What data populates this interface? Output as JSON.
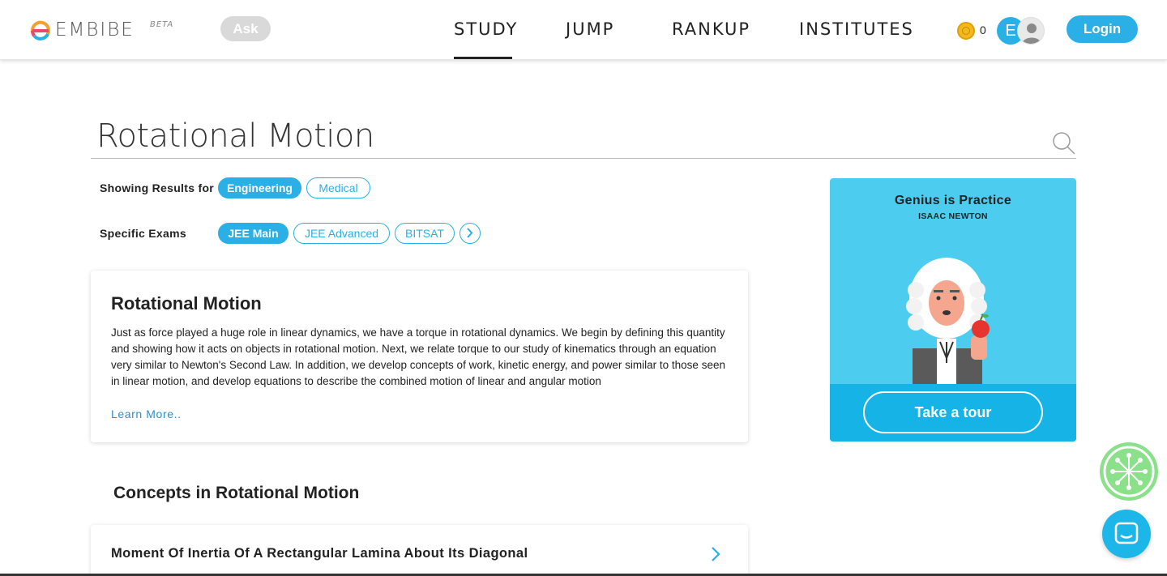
{
  "header": {
    "logo_text": "EMBIBE",
    "logo_badge": "BETA",
    "ask_label": "Ask",
    "nav": [
      "STUDY",
      "JUMP",
      "RANKUP",
      "INSTITUTES"
    ],
    "active_nav": "STUDY",
    "coin_count": "0",
    "avatar_initial": "E",
    "login_label": "Login"
  },
  "search": {
    "query": "Rotational Motion",
    "icon": "search-icon"
  },
  "filters": {
    "results_label": "Showing Results for",
    "results_options": [
      {
        "label": "Engineering",
        "active": true
      },
      {
        "label": "Medical",
        "active": false
      }
    ],
    "exams_label": "Specific Exams",
    "exam_options": [
      {
        "label": "JEE Main",
        "active": true
      },
      {
        "label": "JEE Advanced",
        "active": false
      },
      {
        "label": "BITSAT",
        "active": false
      }
    ]
  },
  "topic_card": {
    "title": "Rotational Motion",
    "body": "Just as force played a huge role in linear dynamics, we have a torque in rotational dynamics. We begin by defining this quantity and showing how it acts on objects in rotational motion. Next, we relate torque to our study of kinematics through an equation very similar to Newton's Second Law. In addition, we develop concepts of work, kinetic energy, and power similar to those seen in linear motion, and develop equations to describe the combined motion of linear and angular motion",
    "learn_more": "Learn More.."
  },
  "concepts": {
    "title": "Concepts in Rotational Motion",
    "items": [
      "Moment Of Inertia Of A Rectangular Lamina About Its Diagonal"
    ]
  },
  "promo": {
    "quote": "Genius is Practice",
    "author": "ISAAC NEWTON",
    "tour_label": "Take a tour"
  },
  "colors": {
    "accent": "#2ab0e6",
    "promo_bg": "#4ccdf0",
    "promo_bottom": "#16b3e7",
    "float_green": "#8be08a"
  }
}
